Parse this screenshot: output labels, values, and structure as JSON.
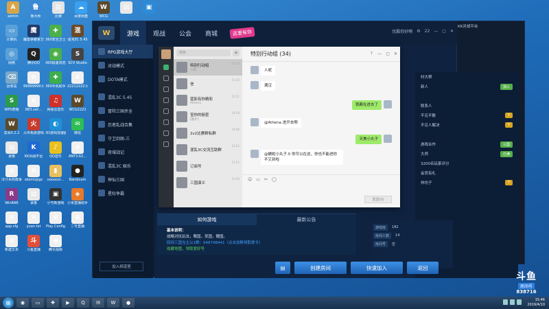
{
  "desktop_icons": [
    {
      "label": "admin",
      "color": "#d8a64a",
      "glyph": "A"
    },
    {
      "label": "鲁大师",
      "color": "#3b87d6",
      "glyph": "鲁"
    },
    {
      "label": "比赛",
      "color": "#e4e4e4",
      "glyph": "▤"
    },
    {
      "label": "百度网盘",
      "color": "#3aa0f0",
      "glyph": "☁"
    },
    {
      "label": "WCG",
      "color": "#5a4a2a",
      "glyph": "W"
    },
    {
      "label": "",
      "color": "#e8e8e8",
      "glyph": "▤"
    },
    {
      "label": "",
      "color": "#2d8bd8",
      "glyph": "▣"
    },
    {
      "label": "计算机",
      "color": "#5aa0d8",
      "glyph": "▭"
    },
    {
      "label": "魔兽争霸官方对战平台",
      "color": "#223a6a",
      "glyph": "魔"
    },
    {
      "label": "360安全卫士",
      "color": "#4bb04b",
      "glyph": "✚"
    },
    {
      "label": "混沌3C 5.45",
      "color": "#6a4a2a",
      "glyph": "混"
    },
    {
      "label": "网络",
      "color": "#5aa0d8",
      "glyph": "◎"
    },
    {
      "label": "腾讯QQ",
      "color": "#222",
      "glyph": "Q"
    },
    {
      "label": "360极速浏览器",
      "color": "#4bb04b",
      "glyph": "◉"
    },
    {
      "label": "SCV Studio",
      "color": "#444",
      "glyph": "S"
    },
    {
      "label": "回收站",
      "color": "#7aa8c8",
      "glyph": "⌫"
    },
    {
      "label": "99999999.txt",
      "color": "#f0f0f0",
      "glyph": "≡"
    },
    {
      "label": "360手机助手",
      "color": "#3cae4c",
      "glyph": "✚"
    },
    {
      "label": "22212222.txt",
      "color": "#f0f0f0",
      "glyph": "≡"
    },
    {
      "label": "WPS表格",
      "color": "#2b9a4b",
      "glyph": "S"
    },
    {
      "label": "883.ssh...",
      "color": "#f0f0f0",
      "glyph": "≡"
    },
    {
      "label": "网易云音乐",
      "color": "#d0302a",
      "glyph": "♫"
    },
    {
      "label": "WCG2222",
      "color": "#5a4a2a",
      "glyph": "W"
    },
    {
      "label": "澎湃3.2.2",
      "color": "#5a4a2a",
      "glyph": "W"
    },
    {
      "label": "火币免费游戏",
      "color": "#c83a2a",
      "glyph": "火"
    },
    {
      "label": "3D游戏加速器",
      "color": "#1e90d8",
      "glyph": "◐"
    },
    {
      "label": "微信",
      "color": "#2ebd52",
      "glyph": "✉"
    },
    {
      "label": "录像",
      "color": "#e8e8e8",
      "glyph": "▤"
    },
    {
      "label": "KK对战平台",
      "color": "#1e6ad0",
      "glyph": "K"
    },
    {
      "label": "QQ音乐",
      "color": "#e8c020",
      "glyph": "♪"
    },
    {
      "label": "ANT3.62...",
      "color": "#f0f0f0",
      "glyph": "≡"
    },
    {
      "label": "冷汗水的故事",
      "color": "#f0f0f0",
      "glyph": "≡"
    },
    {
      "label": "sbsmlzpgs",
      "color": "#f0f0f0",
      "glyph": "≡"
    },
    {
      "label": "ooooovi...",
      "color": "#e8c060",
      "glyph": "▮"
    },
    {
      "label": "Bandicam",
      "color": "#222",
      "glyph": "●"
    },
    {
      "label": "WinRAR",
      "color": "#8a3a8a",
      "glyph": "R"
    },
    {
      "label": "录像",
      "color": "#e8e8e8",
      "glyph": "▤"
    },
    {
      "label": "小号新游戏",
      "color": "#333",
      "glyph": "▣"
    },
    {
      "label": "小米直播助手",
      "color": "#e87a2a",
      "glyph": "◈"
    },
    {
      "label": "app.cfg",
      "color": "#f0f0f0",
      "glyph": "≡"
    },
    {
      "label": "yuan.txt",
      "color": "#f0f0f0",
      "glyph": "≡"
    },
    {
      "label": "Play Config",
      "color": "#f0f0f0",
      "glyph": "≡"
    },
    {
      "label": "二号直播",
      "color": "#f0f0f0",
      "glyph": "≡"
    },
    {
      "label": "新建文本",
      "color": "#f0f0f0",
      "glyph": "≡"
    },
    {
      "label": "斗鱼直播",
      "color": "#e0503a",
      "glyph": "斗"
    },
    {
      "label": "腾讯视频",
      "color": "#f0f0f0",
      "glyph": "◉"
    }
  ],
  "game_window": {
    "tabs": [
      "游戏",
      "观战",
      "公会",
      "商城"
    ],
    "badge": "这里有你",
    "top_right": [
      "优酷你好啊",
      "22"
    ],
    "sidebar": [
      "RPG游戏大厅",
      "对战模式",
      "DOTA模式",
      "混乱3C 5.45",
      "冒险三国杀全",
      "忍者乱战合集",
      "守卫剑阁-三",
      "奇域战记",
      "混乱3C 娱乐",
      "神仙三国",
      "星际争霸"
    ],
    "add_channel": "加入频道室",
    "how_tabs": [
      "如何游戏",
      "最新公告"
    ],
    "how_title": "基本说明：",
    "how_line1": "战略对抗玩法，蜀国，吴国，魏国。",
    "how_line2": "回到三国当主公1群：948748441（点击加群领取爱令）",
    "how_line3": "收藏地图，领取爱好号",
    "buttons": {
      "create": "创建房间",
      "join": "快速加入",
      "back": "返回"
    },
    "right_panel": [
      {
        "l": "村大帮",
        "v": ""
      },
      {
        "l": "新人",
        "v": "加入"
      },
      {
        "l": "联系人",
        "v": ""
      },
      {
        "l": "不见不散",
        "v": "Y"
      },
      {
        "l": "不见人解决",
        "v": "Y"
      },
      {
        "l": "游戏合作",
        "v": "三国"
      },
      {
        "l": "大师",
        "v": "已满"
      },
      {
        "l": "3200名玩家评分",
        "v": ""
      },
      {
        "l": "会员有礼",
        "v": ""
      },
      {
        "l": "仲坊子",
        "v": "Y"
      }
    ],
    "room": {
      "r1": "游戏房",
      "v1": "182",
      "r2": "房间人数",
      "v2": "14",
      "r3": "房间号",
      "v3": "空"
    }
  },
  "chat": {
    "search_placeholder": "搜索",
    "add": "+",
    "title": "特别行动组 (34)",
    "list": [
      {
        "name": "特别行动组",
        "preview": "人呢",
        "time": "15:36"
      },
      {
        "name": "信",
        "preview": "",
        "time": "15:20"
      },
      {
        "name": "蓝影有你精彩",
        "preview": "Athena",
        "time": "15:11"
      },
      {
        "name": "宝你的秘密",
        "preview": "[图片]",
        "time": "14:58"
      },
      {
        "name": "2v2比赛群私群",
        "preview": "",
        "time": "14:40"
      },
      {
        "name": "混乱3C交流互助群",
        "preview": "",
        "time": "14:22"
      },
      {
        "name": "订阅号",
        "preview": "",
        "time": "13:51"
      },
      {
        "name": "三国演义",
        "preview": "",
        "time": "13:30"
      }
    ],
    "messages": [
      {
        "who": "人呢",
        "me": false
      },
      {
        "who": "满汉",
        "me": false
      },
      {
        "who": "我都在进去了",
        "me": true
      },
      {
        "who": "@Athena 进开去啊",
        "me": false
      },
      {
        "who": "天美小丸子",
        "me": true
      },
      {
        "who": "@蠕蛇小丸子.0 你可以在这，你也不能进你不又到啦",
        "me": false
      }
    ],
    "send": "发送(S)"
  },
  "taskbar": {
    "clock_time": "15:46",
    "clock_date": "2019/4/10"
  },
  "watermark": {
    "l1": "斗鱼",
    "l2": "房间号",
    "l3": "838716"
  }
}
